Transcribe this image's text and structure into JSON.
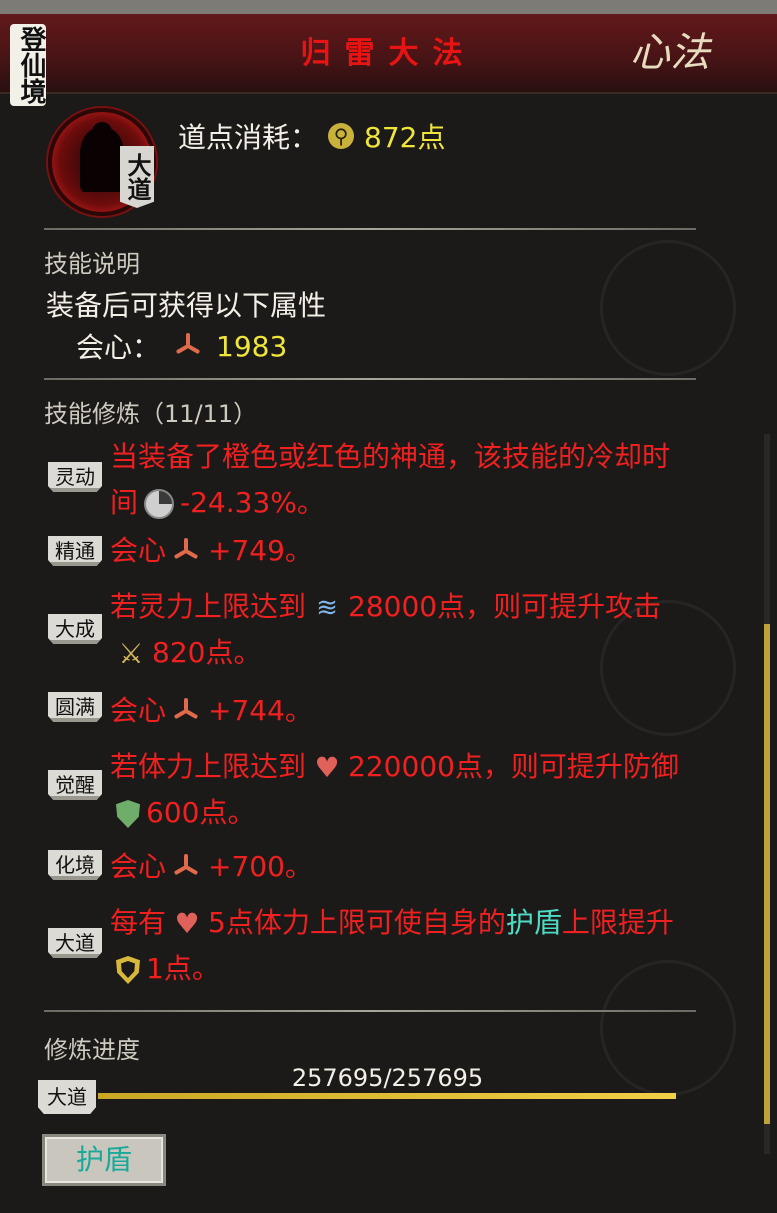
{
  "header": {
    "title": "归雷大法",
    "xinfa_label": "心法"
  },
  "realm_tag": "登仙境",
  "grade_tag": "大道",
  "cost": {
    "label": "道点消耗：",
    "value": "872点"
  },
  "skill_desc": {
    "section_title": "技能说明",
    "text": "装备后可获得以下属性",
    "attr_label": "会心：",
    "attr_value": "1983"
  },
  "refine": {
    "section_title": "技能修炼（11/11）",
    "rows": [
      {
        "badge": "灵动",
        "line1": "当装备了橙色或红色的神通，该技能的冷却时",
        "line2_pre": "间",
        "line2_post": "-24.33%。"
      },
      {
        "badge": "精通",
        "text_pre": "会心",
        "text_post": "+749。"
      },
      {
        "badge": "大成",
        "line1_pre": "若灵力上限达到",
        "line1_post": "28000点，则可提升攻击",
        "line2_post": "820点。"
      },
      {
        "badge": "圆满",
        "text_pre": "会心",
        "text_post": "+744。"
      },
      {
        "badge": "觉醒",
        "line1_pre": "若体力上限达到",
        "line1_post": "220000点，则可提升防御",
        "line2_post": "600点。"
      },
      {
        "badge": "化境",
        "text_pre": "会心",
        "text_post": "+700。"
      },
      {
        "badge": "大道",
        "line1_pre": "每有",
        "line1_mid": "5点体力上限可使自身的",
        "line1_cyan": "护盾",
        "line1_post": "上限提升",
        "line2_post": "1点。"
      }
    ]
  },
  "progress": {
    "section_title": "修炼进度",
    "label": "大道",
    "text": "257695/257695",
    "fraction": 1.0
  },
  "shield_button": "护盾",
  "icons": {
    "skill": "warrior-silhouette-icon",
    "cost": "dao-point-icon",
    "crit": "crit-icon",
    "cooldown": "cooldown-clock-icon",
    "spirit": "spirit-power-icon",
    "attack": "crossed-swords-icon",
    "health": "heart-icon",
    "defense": "green-shield-icon",
    "shield": "gold-shield-icon"
  },
  "colors": {
    "effect_text": "#ee2020",
    "highlight_cyan": "#4fdcc6",
    "value_yellow": "#f0e53a"
  }
}
